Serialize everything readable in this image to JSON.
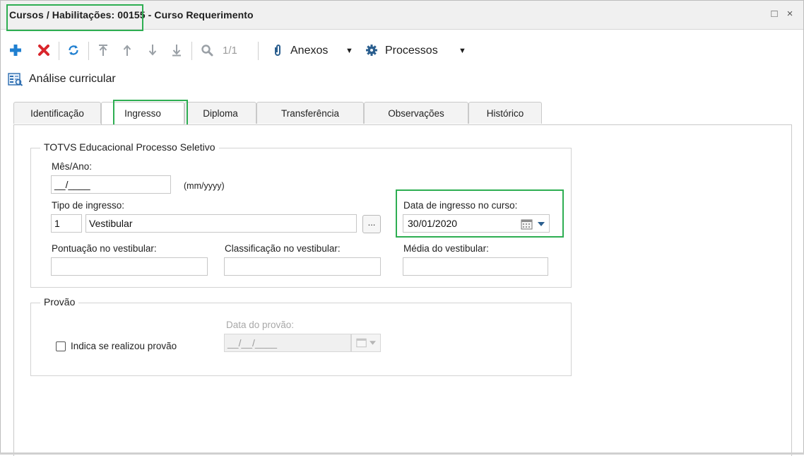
{
  "window": {
    "title": "Cursos / Habilitações: 00155 - Curso Requerimento",
    "controls": {
      "maximize": "□",
      "close": "×"
    }
  },
  "toolbar": {
    "add_icon": "plus-icon",
    "delete_icon": "close-icon",
    "refresh_icon": "refresh-icon",
    "first_icon": "arrow-first-icon",
    "prev_icon": "arrow-up-icon",
    "next_icon": "arrow-down-icon",
    "last_icon": "arrow-last-icon",
    "search_icon": "search-icon",
    "record_counter": "1/1",
    "attachments_label": "Anexos",
    "processes_label": "Processos"
  },
  "section": {
    "title": "Análise curricular"
  },
  "tabs": [
    {
      "label": "Identificação"
    },
    {
      "label": "Ingresso",
      "active": true
    },
    {
      "label": "Diploma"
    },
    {
      "label": "Transferência"
    },
    {
      "label": "Observações"
    },
    {
      "label": "Histórico"
    }
  ],
  "processo_seletivo": {
    "legend": "TOTVS Educacional Processo Seletivo",
    "mes_ano_label": "Mês/Ano:",
    "mes_ano_value": "__/____",
    "mes_ano_hint": "(mm/yyyy)",
    "tipo_ingresso_label": "Tipo de ingresso:",
    "tipo_ingresso_code": "1",
    "tipo_ingresso_desc": "Vestibular",
    "lookup_label": "...",
    "data_ingresso_label": "Data de ingresso no curso:",
    "data_ingresso_value": "30/01/2020",
    "pontuacao_label": "Pontuação no vestibular:",
    "pontuacao_value": "",
    "classificacao_label": "Classificação no vestibular:",
    "classificacao_value": "",
    "media_label": "Média do vestibular:",
    "media_value": ""
  },
  "provao": {
    "legend": "Provão",
    "checkbox_label": "Indica se realizou provão",
    "checked": false,
    "data_label": "Data do provão:",
    "data_value": "__/__/____"
  },
  "colors": {
    "highlight": "#2eae52",
    "add": "#1f7fd0",
    "delete": "#d9262c",
    "refresh": "#1f7fd0"
  }
}
